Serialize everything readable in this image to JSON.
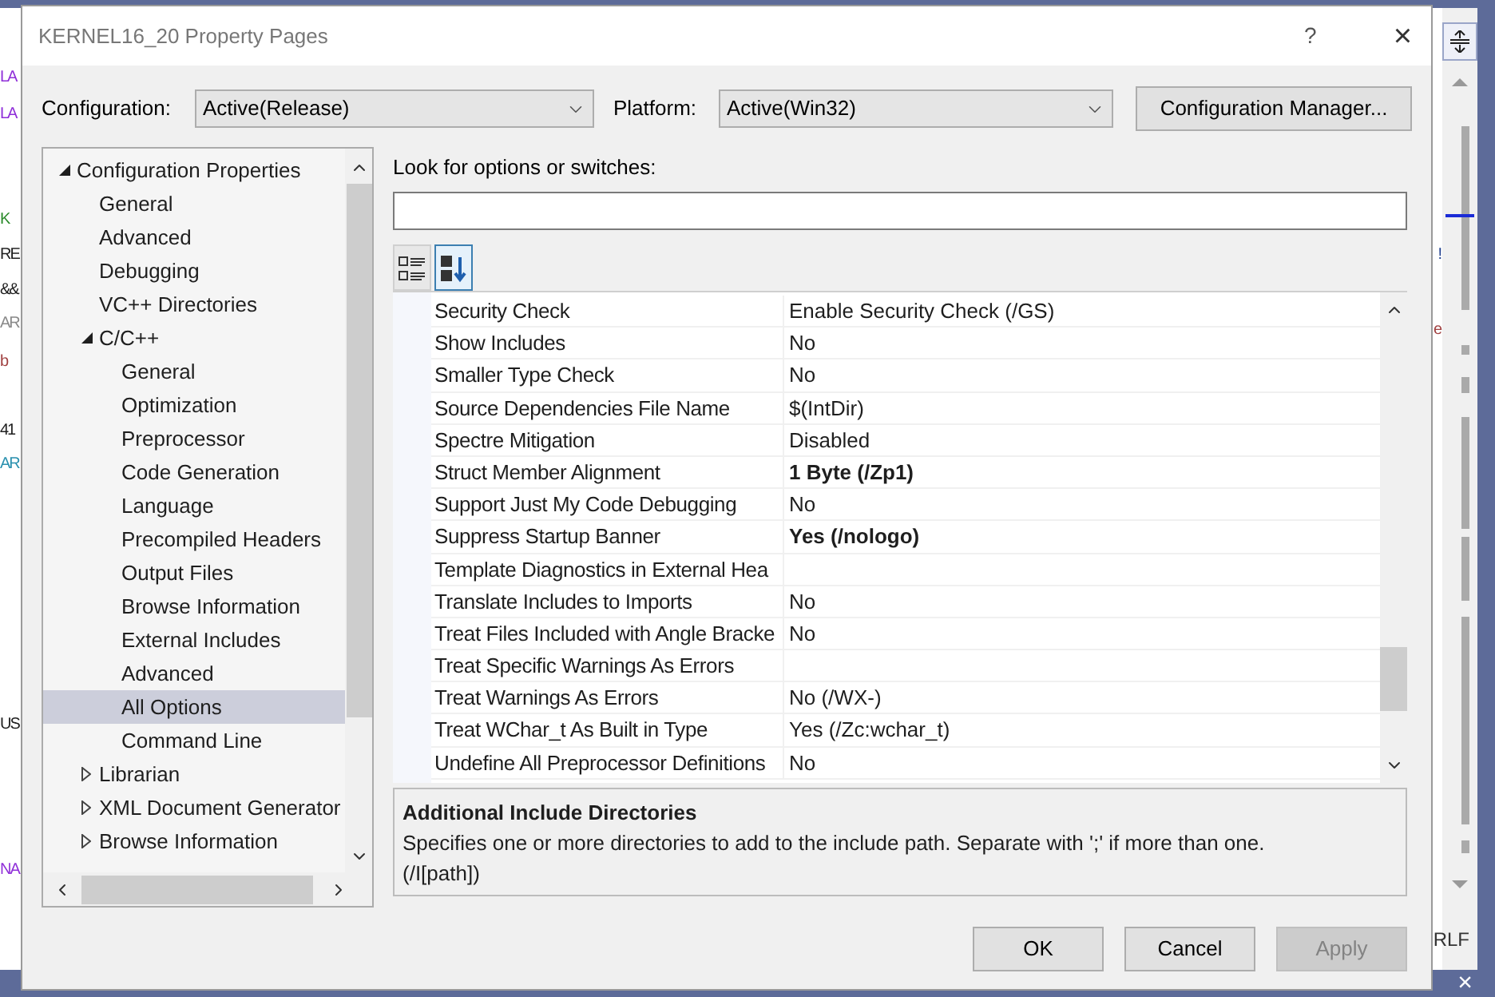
{
  "background_editor": {
    "left_fragments": [
      {
        "text": "LA",
        "color": "#8f2fd8"
      },
      {
        "text": "LA",
        "color": "#8f2fd8"
      },
      {
        "text": "K",
        "color": "#2a8a2a"
      },
      {
        "text": "RE",
        "color": "#1e1e1e"
      },
      {
        "text": "&&",
        "color": "#1e1e1e"
      },
      {
        "text": "AR",
        "color": "#8a8a8a"
      },
      {
        "text": "b",
        "color": "#a04040"
      },
      {
        "text": "41",
        "color": "#1e1e1e"
      },
      {
        "text": "AR",
        "color": "#2b91af"
      },
      {
        "text": "US",
        "color": "#1e1e1e"
      },
      {
        "text": "NA",
        "color": "#8f2fd8"
      }
    ],
    "right_fragments": [
      {
        "text": "!",
        "color": "#1f3f8f"
      },
      {
        "text": "e",
        "color": "#a04040"
      }
    ],
    "status_text": "RLF",
    "close_glyph": "×"
  },
  "window": {
    "title": "KERNEL16_20 Property Pages",
    "help_glyph": "?",
    "close_glyph": "×"
  },
  "configuration": {
    "label": "Configuration:",
    "value": "Active(Release)"
  },
  "platform": {
    "label": "Platform:",
    "value": "Active(Win32)"
  },
  "configuration_manager_button": "Configuration Manager...",
  "tree": [
    {
      "label": "Configuration Properties",
      "expanded": true,
      "selected": false,
      "children": [
        {
          "label": "General",
          "selected": false
        },
        {
          "label": "Advanced",
          "selected": false
        },
        {
          "label": "Debugging",
          "selected": false
        },
        {
          "label": "VC++ Directories",
          "selected": false
        },
        {
          "label": "C/C++",
          "expanded": true,
          "selected": false,
          "children": [
            {
              "label": "General",
              "selected": false
            },
            {
              "label": "Optimization",
              "selected": false
            },
            {
              "label": "Preprocessor",
              "selected": false
            },
            {
              "label": "Code Generation",
              "selected": false
            },
            {
              "label": "Language",
              "selected": false
            },
            {
              "label": "Precompiled Headers",
              "selected": false
            },
            {
              "label": "Output Files",
              "selected": false
            },
            {
              "label": "Browse Information",
              "selected": false
            },
            {
              "label": "External Includes",
              "selected": false
            },
            {
              "label": "Advanced",
              "selected": false
            },
            {
              "label": "All Options",
              "selected": true
            },
            {
              "label": "Command Line",
              "selected": false
            }
          ]
        },
        {
          "label": "Librarian",
          "expanded": false,
          "selected": false
        },
        {
          "label": "XML Document Generator",
          "expanded": false,
          "selected": false
        },
        {
          "label": "Browse Information",
          "expanded": false,
          "selected": false
        }
      ]
    }
  ],
  "search": {
    "label": "Look for options or switches:"
  },
  "view_buttons": [
    {
      "kind": "categorized",
      "selected": false
    },
    {
      "kind": "alphabetical",
      "selected": true
    }
  ],
  "properties": [
    {
      "name": "Security Check",
      "value": "Enable Security Check (/GS)",
      "modified": false
    },
    {
      "name": "Show Includes",
      "value": "No",
      "modified": false
    },
    {
      "name": "Smaller Type Check",
      "value": "No",
      "modified": false
    },
    {
      "name": "Source Dependencies File Name",
      "value": "$(IntDir)",
      "modified": false
    },
    {
      "name": "Spectre Mitigation",
      "value": "Disabled",
      "modified": false
    },
    {
      "name": "Struct Member Alignment",
      "value": "1 Byte (/Zp1)",
      "modified": true
    },
    {
      "name": "Support Just My Code Debugging",
      "value": "No",
      "modified": false
    },
    {
      "name": "Suppress Startup Banner",
      "value": "Yes (/nologo)",
      "modified": true
    },
    {
      "name": "Template Diagnostics in External Hea"
    },
    {
      "name": "Translate Includes to Imports",
      "value": "No",
      "modified": false
    },
    {
      "name": "Treat Files Included with Angle Bracke",
      "value": "No",
      "modified": false
    },
    {
      "name": "Treat Specific Warnings As Errors"
    },
    {
      "name": "Treat Warnings As Errors",
      "value": "No (/WX-)",
      "modified": false
    },
    {
      "name": "Treat WChar_t As Built in Type",
      "value": "Yes (/Zc:wchar_t)",
      "modified": false
    },
    {
      "name": "Undefine All Preprocessor Definitions",
      "value": "No",
      "modified": false
    }
  ],
  "description": {
    "title": "Additional Include Directories",
    "text": "Specifies one or more directories to add to the include path. Separate with ';' if more than one.",
    "switch": "(/I[path])"
  },
  "buttons": [
    {
      "label": "OK",
      "disabled": false
    },
    {
      "label": "Cancel",
      "disabled": false
    },
    {
      "label": "Apply",
      "disabled": true
    }
  ]
}
